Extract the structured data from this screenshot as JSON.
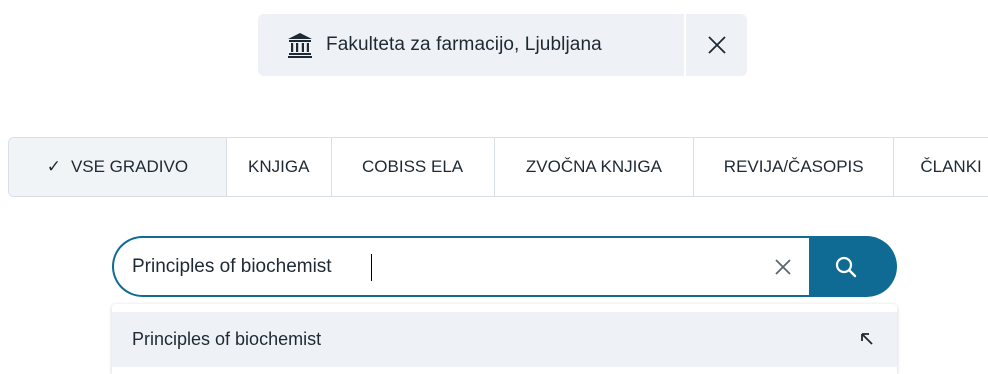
{
  "filter_chip": {
    "label": "Fakulteta za farmacijo, Ljubljana",
    "icon": "institution-icon",
    "close_icon": "close-icon"
  },
  "tabs": [
    {
      "label": "VSE GRADIVO",
      "active": true
    },
    {
      "label": "KNJIGA",
      "active": false
    },
    {
      "label": "COBISS ELA",
      "active": false
    },
    {
      "label": "ZVOČNA KNJIGA",
      "active": false
    },
    {
      "label": "REVIJA/ČASOPIS",
      "active": false
    },
    {
      "label": "ČLANKI",
      "active": false
    }
  ],
  "search": {
    "value": "Principles of biochemist",
    "clear_icon": "clear-icon",
    "submit_icon": "search-icon"
  },
  "suggestions": [
    {
      "text": "Principles of biochemist",
      "icon": "arrow-up-left-icon"
    }
  ],
  "colors": {
    "accent": "#0f6b94",
    "chip_bg": "#eef1f5",
    "border": "#d9dfe6"
  }
}
